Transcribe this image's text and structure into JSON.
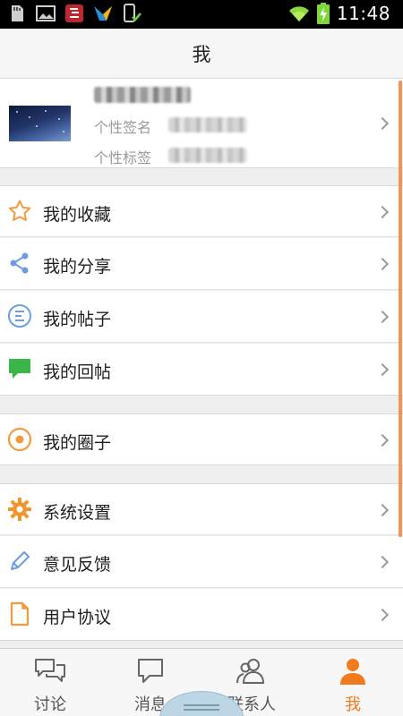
{
  "status_bar": {
    "time": "11:48",
    "left_icons": [
      "sd-card-icon",
      "gallery-icon",
      "app-notification-icon",
      "bird-app-icon",
      "phone-check-icon"
    ],
    "right_icons": [
      "wifi-icon",
      "battery-charging-icon"
    ]
  },
  "header": {
    "title": "我"
  },
  "profile": {
    "signature_label": "个性签名",
    "tag_label": "个性标签",
    "avatar_icon": "starry-sky-avatar"
  },
  "menu": {
    "group1": [
      {
        "id": "favorites",
        "label": "我的收藏",
        "icon": "star-icon"
      },
      {
        "id": "shares",
        "label": "我的分享",
        "icon": "share-icon"
      },
      {
        "id": "posts",
        "label": "我的帖子",
        "icon": "posts-icon"
      },
      {
        "id": "replies",
        "label": "我的回帖",
        "icon": "reply-bubble-icon"
      }
    ],
    "group2": [
      {
        "id": "circles",
        "label": "我的圈子",
        "icon": "circle-target-icon"
      }
    ],
    "group3": [
      {
        "id": "settings",
        "label": "系统设置",
        "icon": "gear-icon"
      },
      {
        "id": "feedback",
        "label": "意见反馈",
        "icon": "pencil-icon"
      },
      {
        "id": "agreement",
        "label": "用户协议",
        "icon": "document-icon"
      }
    ]
  },
  "tabs": [
    {
      "id": "discuss",
      "label": "讨论",
      "icon": "chat-bubbles-icon",
      "active": false
    },
    {
      "id": "messages",
      "label": "消息",
      "icon": "message-bubble-icon",
      "active": false
    },
    {
      "id": "contacts",
      "label": "联系人",
      "icon": "contacts-icon",
      "active": false
    },
    {
      "id": "me",
      "label": "我",
      "icon": "person-icon",
      "active": true
    }
  ],
  "colors": {
    "accent": "#f07b1f",
    "star": "#f39a3c",
    "share": "#6a9ee0",
    "reply": "#39b54a",
    "circle": "#f39a3c",
    "gear": "#f0962f",
    "pencil": "#6a9ee0",
    "doc": "#f39a3c"
  }
}
